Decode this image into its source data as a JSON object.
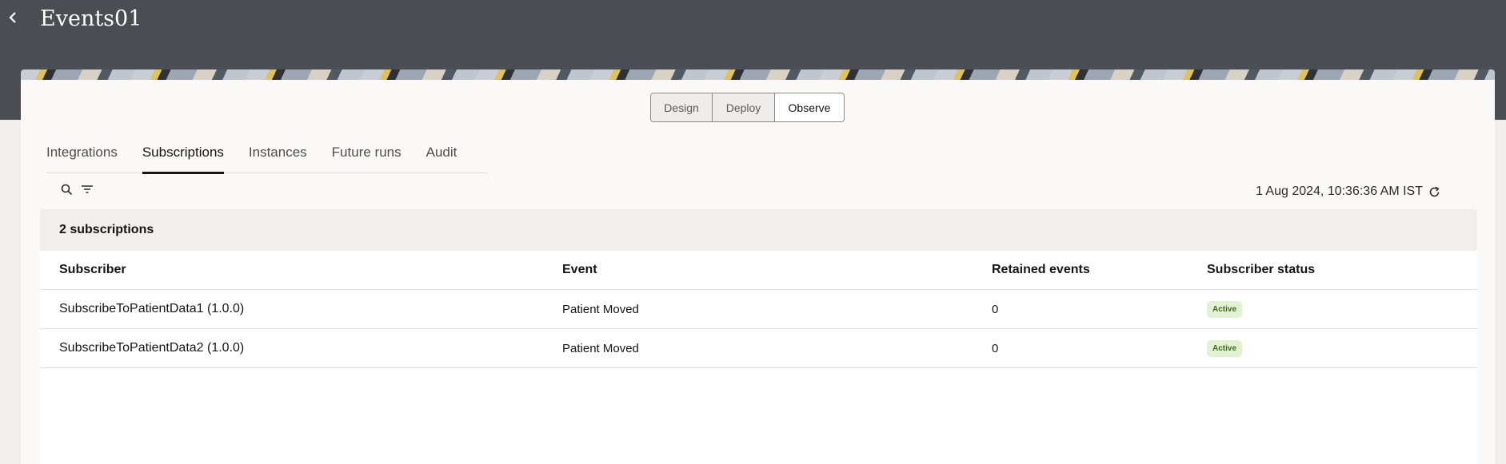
{
  "header": {
    "title": "Events01",
    "back_icon": "chevron-left-icon"
  },
  "mode_switch": [
    "Design",
    "Deploy",
    "Observe"
  ],
  "mode_selected": "Observe",
  "tabs": [
    "Integrations",
    "Subscriptions",
    "Instances",
    "Future runs",
    "Audit"
  ],
  "tab_selected": "Subscriptions",
  "toolbar": {
    "search_icon": "search-icon",
    "filter_icon": "filter-icon",
    "refresh_icon": "refresh-icon"
  },
  "timestamp": "1 Aug 2024, 10:36:36 AM IST",
  "summary": "2 subscriptions",
  "table": {
    "columns": [
      "Subscriber",
      "Event",
      "Retained events",
      "Subscriber status"
    ],
    "rows": [
      {
        "subscriber": "SubscribeToPatientData1 (1.0.0)",
        "event": "Patient Moved",
        "retained": "0",
        "status": "Active"
      },
      {
        "subscriber": "SubscribeToPatientData2 (1.0.0)",
        "event": "Patient Moved",
        "retained": "0",
        "status": "Active"
      }
    ]
  },
  "colors": {
    "header_bg": "#4a4d54",
    "active_badge_bg": "#e2f0d4",
    "active_badge_text": "#3d6a1c"
  }
}
